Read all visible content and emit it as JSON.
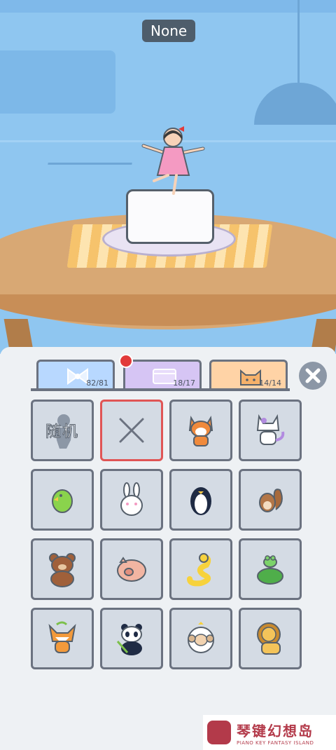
{
  "header": {
    "selected_name": "None"
  },
  "tabs": [
    {
      "name": "bow",
      "icon": "bow-icon",
      "count": "82/81",
      "color": "#b8d8ff"
    },
    {
      "name": "box",
      "icon": "box-icon",
      "count": "18/17",
      "color": "#d6c5f4",
      "has_notification": true
    },
    {
      "name": "animals",
      "icon": "cat-face-icon",
      "count": "14/14",
      "color": "#ffd3a6",
      "active": true
    }
  ],
  "grid": {
    "random_label": "随机",
    "items": [
      {
        "name": "random",
        "icon": "silhouette-icon"
      },
      {
        "name": "none",
        "icon": "x-icon",
        "selected": true
      },
      {
        "name": "shiba",
        "icon": "shiba-dog-icon"
      },
      {
        "name": "cat",
        "icon": "cat-icon"
      },
      {
        "name": "parrot",
        "icon": "parrot-icon"
      },
      {
        "name": "rabbit",
        "icon": "rabbit-icon"
      },
      {
        "name": "penguin",
        "icon": "penguin-icon"
      },
      {
        "name": "squirrel",
        "icon": "squirrel-icon"
      },
      {
        "name": "bear",
        "icon": "bear-icon"
      },
      {
        "name": "pig",
        "icon": "pig-icon"
      },
      {
        "name": "snake",
        "icon": "snake-icon"
      },
      {
        "name": "turtle",
        "icon": "turtle-frog-icon"
      },
      {
        "name": "fox",
        "icon": "fox-icon"
      },
      {
        "name": "panda",
        "icon": "panda-icon"
      },
      {
        "name": "sheep",
        "icon": "sheep-icon"
      },
      {
        "name": "lion",
        "icon": "lion-icon"
      }
    ]
  },
  "watermark": {
    "cn": "琴键幻想岛",
    "en": "PIANO KEY FANTASY ISLAND"
  },
  "colors": {
    "accent_red": "#e05555",
    "panel": "#eef1f4",
    "cell": "#d4dbe4"
  }
}
